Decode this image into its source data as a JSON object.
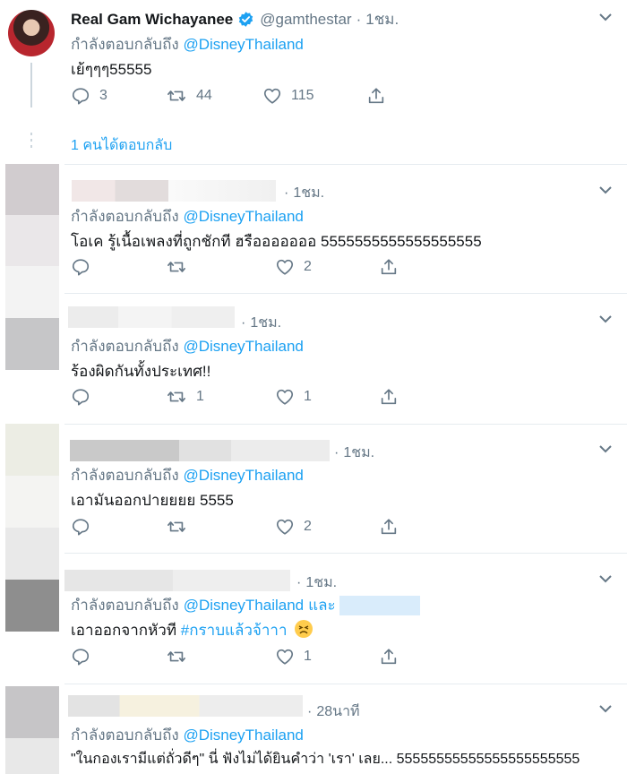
{
  "main_tweet": {
    "name": "Real Gam Wichayanee",
    "handle": "@gamthestar",
    "separator": "·",
    "time": "1ชม.",
    "reply_prefix": "กำลังตอบกลับถึง",
    "mention": "@DisneyThailand",
    "text": "เย้ๆๆๆ55555",
    "replies": "3",
    "retweets": "44",
    "likes": "115",
    "thread_link": "1 คนได้ตอบกลับ"
  },
  "replies": [
    {
      "time": "1ชม.",
      "reply_prefix": "กำลังตอบกลับถึง",
      "mention": "@DisneyThailand",
      "text": "โอเค รู้เนื้อเพลงที่ถูกชักที ฮรือออออออ 5555555555555555555",
      "reply_count": "",
      "retweet_count": "",
      "like_count": "2"
    },
    {
      "time": "1ชม.",
      "reply_prefix": "กำลังตอบกลับถึง",
      "mention": "@DisneyThailand",
      "text": "ร้องผิดกันทั้งประเทศ!!",
      "reply_count": "",
      "retweet_count": "1",
      "like_count": "1"
    },
    {
      "time": "1ชม.",
      "reply_prefix": "กำลังตอบกลับถึง",
      "mention": "@DisneyThailand",
      "text": "เอามันออกปายยยย 5555",
      "reply_count": "",
      "retweet_count": "",
      "like_count": "2"
    },
    {
      "time": "1ชม.",
      "reply_prefix": "กำลังตอบกลับถึง",
      "mention": "@DisneyThailand",
      "and_word": "และ",
      "text": "เอาออกจากหัวที ",
      "hashtag": "#กราบแล้วจ้าาา",
      "emoji": "😣",
      "reply_count": "",
      "retweet_count": "",
      "like_count": "1"
    },
    {
      "time": "28นาที",
      "reply_prefix": "กำลังตอบกลับถึง",
      "mention": "@DisneyThailand",
      "text": "\"ในกองเรามีแต่ถั่วดีๆ\" นี่ ฟังไม่ได้ยินคำว่า 'เรา' เลย... 55555555555555555555555"
    }
  ],
  "colors": {
    "accent": "#1da1f2",
    "muted": "#657786",
    "text": "#14171a",
    "divider": "#e6ecf0",
    "like_red": "#e0245e"
  },
  "icons": [
    "reply-icon",
    "retweet-icon",
    "like-icon",
    "share-icon",
    "chevron-down-icon",
    "verified-badge-icon"
  ]
}
